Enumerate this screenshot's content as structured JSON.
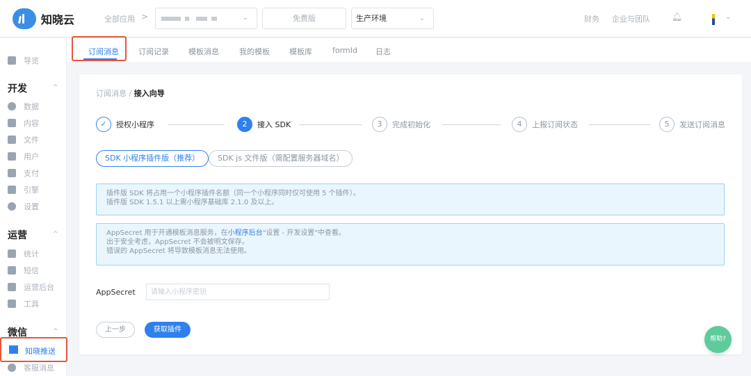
{
  "header": {
    "logo_text": "知晓云",
    "all_apps": "全部应用",
    "crumb_arrow": ">",
    "plan": "免费版",
    "environment": "生产环境",
    "finance": "财务",
    "team": "企业与团队",
    "icons": {
      "logo": "cloud-logo-icon",
      "bell": "bell-icon",
      "chevron": "chevron-down-icon"
    }
  },
  "sidebar": {
    "overview": "导览",
    "sections": [
      {
        "title": "开发",
        "items": [
          "数据",
          "内容",
          "文件",
          "用户",
          "支付",
          "引擎",
          "设置"
        ]
      },
      {
        "title": "运营",
        "items": [
          "统计",
          "短信",
          "运营后台",
          "工具"
        ]
      },
      {
        "title": "微信",
        "items": [
          "知晓推送",
          "客服消息"
        ]
      }
    ],
    "active_item": "知晓推送"
  },
  "tabs": [
    "订阅消息",
    "订阅记录",
    "模板消息",
    "我的模板",
    "模板库",
    "formId",
    "日志"
  ],
  "active_tab": "订阅消息",
  "breadcrumb": {
    "parent": "订阅消息",
    "separator": "/",
    "current": "接入向导"
  },
  "steps": [
    {
      "num": "✓",
      "label": "授权小程序",
      "state": "done"
    },
    {
      "num": "2",
      "label": "接入 SDK",
      "state": "current"
    },
    {
      "num": "3",
      "label": "完成初始化",
      "state": "pending"
    },
    {
      "num": "4",
      "label": "上报订阅状态",
      "state": "pending"
    },
    {
      "num": "5",
      "label": "发送订阅消息",
      "state": "pending"
    }
  ],
  "sdk_options": [
    "SDK 小程序插件版（推荐）",
    "SDK js 文件版（需配置服务器域名）"
  ],
  "notice1": [
    "插件版 SDK 将占用一个小程序插件名额（同一个小程序同时仅可使用 5 个插件）。",
    "插件版 SDK 1.5.1 以上需小程序基础库 2.1.0 及以上。"
  ],
  "notice2": {
    "line1_pre": "AppSecret 用于开通模板消息服务，在",
    "line1_link": "小程序后台",
    "line1_post": "\"设置 - 开发设置\"中查看。",
    "line2": "出于安全考虑，AppSecret 不会被明文保存。",
    "line3": "错误的 AppSecret 将导致模板消息无法使用。"
  },
  "appsecret": {
    "label": "AppSecret",
    "placeholder": "请输入小程序密钥",
    "value": ""
  },
  "buttons": {
    "prev": "上一步",
    "next": "获取插件",
    "help": "帮助?"
  },
  "colors": {
    "primary": "#2f80ed",
    "highlight": "#e8543a",
    "help": "#5dcb9c",
    "notice_bg": "#eaf6fd"
  }
}
